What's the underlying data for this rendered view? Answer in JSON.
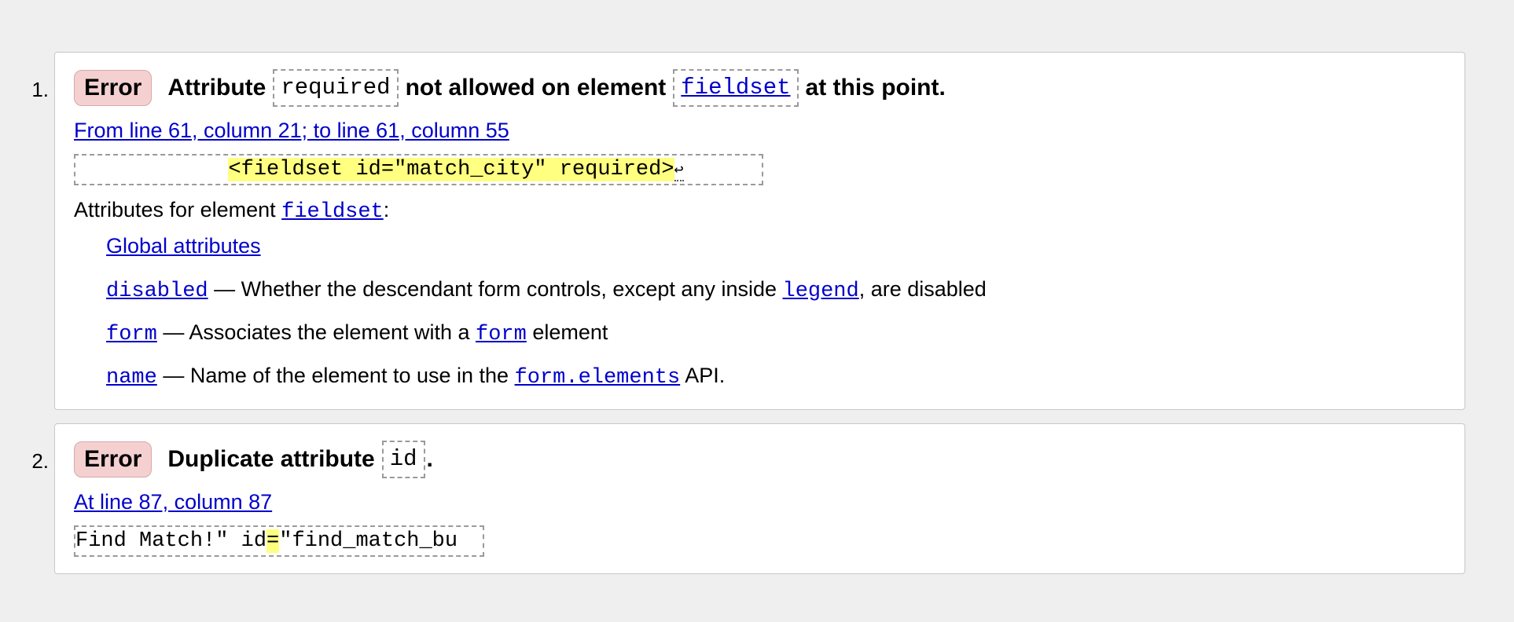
{
  "messages": [
    {
      "number": "1.",
      "badge": "Error",
      "headline": {
        "part1": "Attribute",
        "code1": "required",
        "part2": "not allowed on element",
        "code2": "fieldset",
        "part3": "at this point."
      },
      "location": "From line 61, column 21; to line 61, column 55",
      "extract": {
        "prefix": "            ",
        "highlight": "<fieldset id=\"match_city\" required>",
        "linefeed": "↩"
      },
      "attributes_title": {
        "prefix": "Attributes for element",
        "element": "fieldset",
        "suffix": ":"
      },
      "attributes": {
        "global": "Global attributes",
        "disabled": {
          "name": "disabled",
          "desc1": " — Whether the descendant form controls, except any inside ",
          "code": "legend",
          "desc2": ", are disabled"
        },
        "form": {
          "name": "form",
          "desc1": " — Associates the element with a ",
          "code": "form",
          "desc2": " element"
        },
        "name": {
          "name": "name",
          "desc1": " — Name of the element to use in the ",
          "code": "form.elements",
          "desc2": " API."
        }
      }
    },
    {
      "number": "2.",
      "badge": "Error",
      "headline": {
        "part1": "Duplicate attribute",
        "code1": "id",
        "part2": "."
      },
      "location": "At line 87, column 87",
      "extract": {
        "before": "Find Match!\" id",
        "highlight": "=",
        "after": "\"find_match_bu"
      }
    }
  ],
  "colors": {
    "background": "#efefef",
    "badge_bg": "#f4d0d0",
    "link": "#0000cc",
    "highlight": "#ffff80"
  }
}
